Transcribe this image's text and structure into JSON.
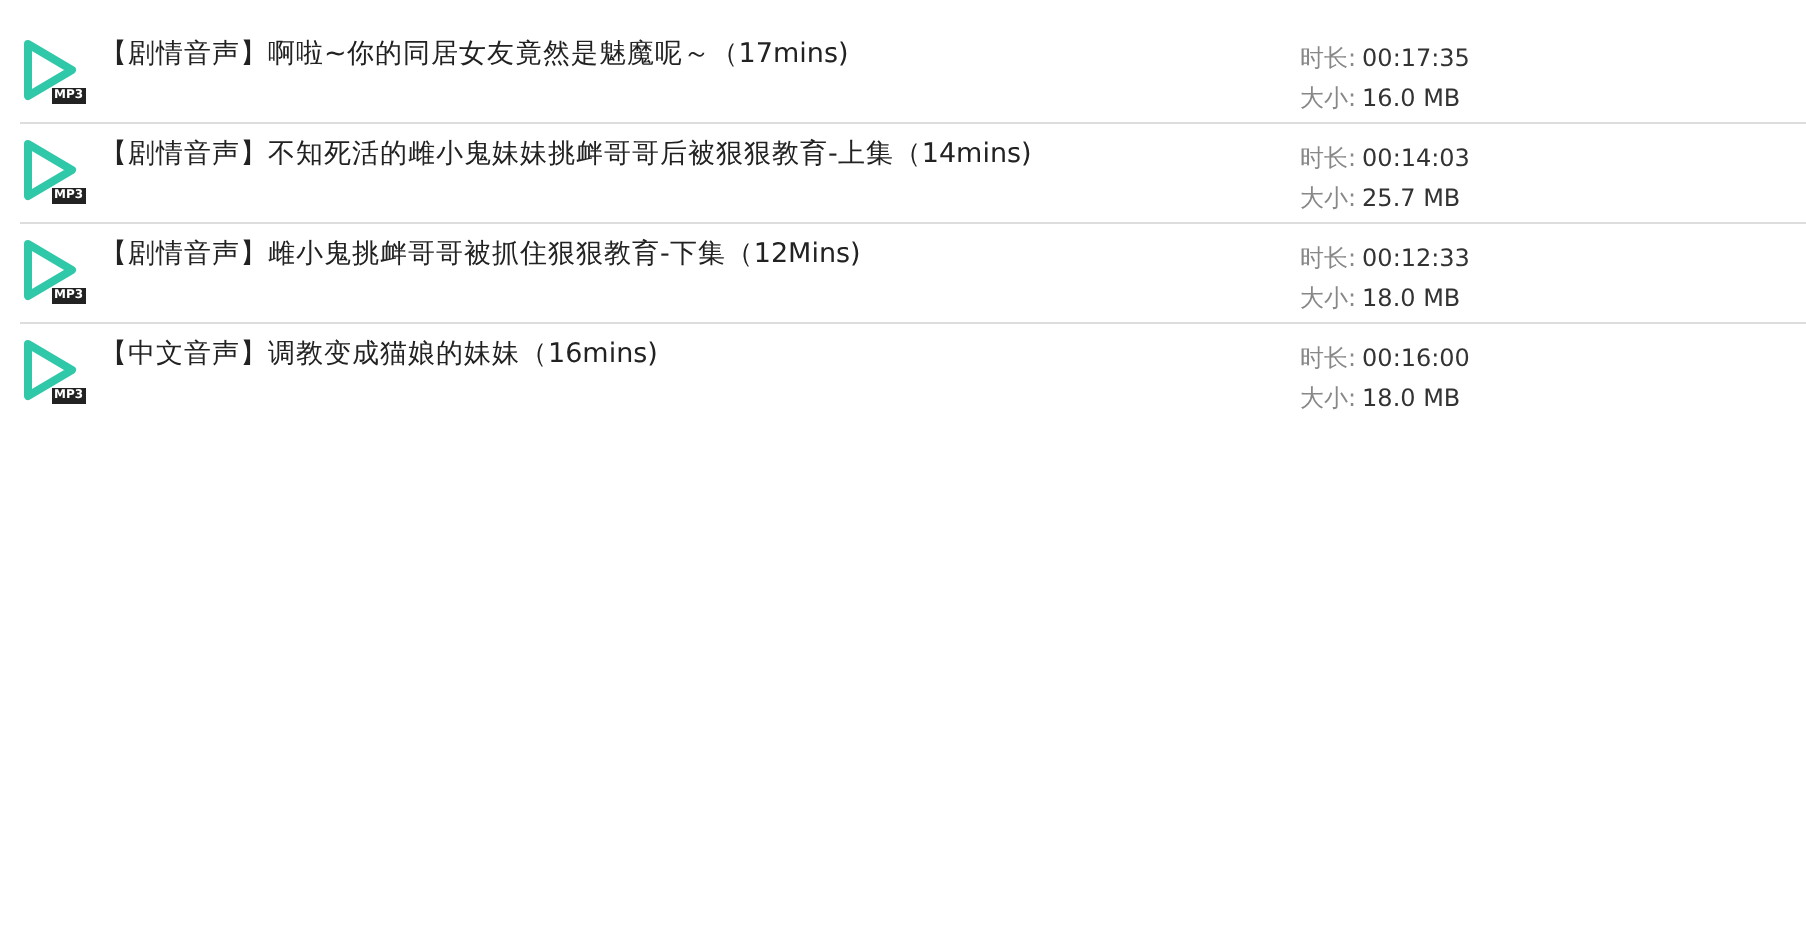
{
  "tracks": [
    {
      "badge": "MP3",
      "title": "【剧情音声】啊啦~你的同居女友竟然是魅魔呢～（17mins)",
      "duration_label": "时长:",
      "duration": "00:17:35",
      "size_label": "大小:",
      "size": "16.0 MB"
    },
    {
      "badge": "MP3",
      "title": "【剧情音声】不知死活的雌小鬼妹妹挑衅哥哥后被狠狠教育-上集（14mins)",
      "duration_label": "时长:",
      "duration": "00:14:03",
      "size_label": "大小:",
      "size": "25.7 MB"
    },
    {
      "badge": "MP3",
      "title": "【剧情音声】雌小鬼挑衅哥哥被抓住狠狠教育-下集（12Mins)",
      "duration_label": "时长:",
      "duration": "00:12:33",
      "size_label": "大小:",
      "size": "18.0 MB"
    },
    {
      "badge": "MP3",
      "title": "【中文音声】调教变成猫娘的妹妹（16mins)",
      "duration_label": "时长:",
      "duration": "00:16:00",
      "size_label": "大小:",
      "size": "18.0 MB"
    }
  ]
}
